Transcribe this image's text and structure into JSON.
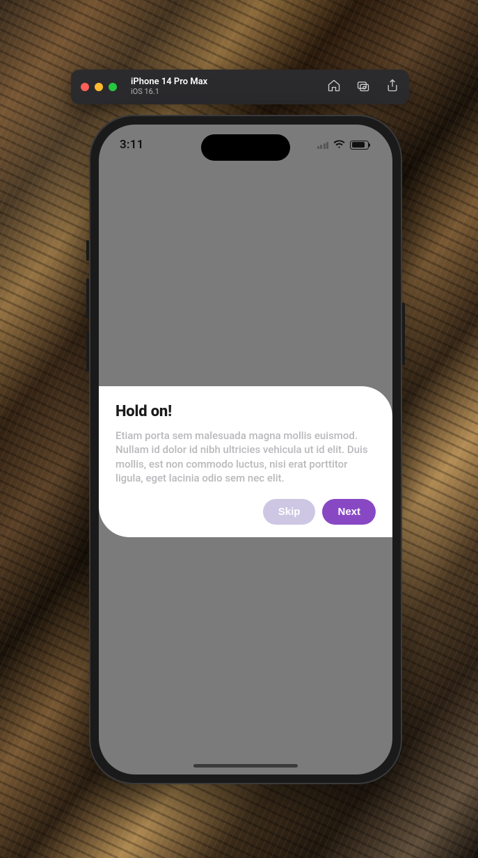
{
  "simulator": {
    "device_name": "iPhone 14 Pro Max",
    "os_version": "iOS 16.1"
  },
  "status_bar": {
    "time": "3:11"
  },
  "card": {
    "title": "Hold on!",
    "body": "Etiam porta sem malesuada magna mollis euismod. Nullam id dolor id nibh ultricies vehicula ut id elit. Duis mollis, est non commodo luctus, nisi erat porttitor ligula, eget lacinia odio sem nec elit.",
    "skip_label": "Skip",
    "next_label": "Next"
  },
  "colors": {
    "accent": "#8848c4",
    "accent_light": "#cdc7e4",
    "screen_bg": "#7b7b7b"
  }
}
